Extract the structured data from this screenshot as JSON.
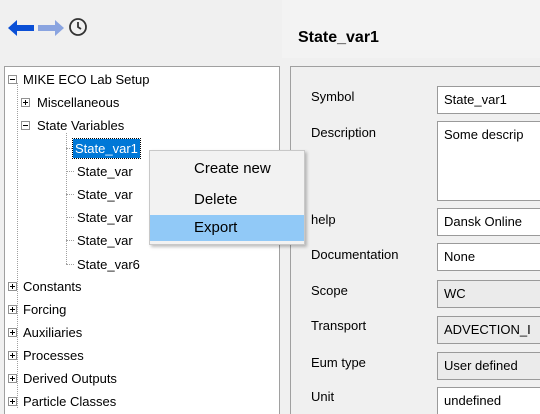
{
  "header": {
    "title": "State_var1"
  },
  "nav": {
    "back_icon": "arrow-left-icon",
    "forward_icon": "arrow-right-icon",
    "history_icon": "clock-icon",
    "accent": "#0a4fd6",
    "disabled": "#8aa4e0"
  },
  "tree": {
    "root": "MIKE ECO Lab Setup",
    "miscellaneous": "Miscellaneous",
    "state_variables": "State Variables",
    "state_vars": [
      "State_var1",
      "State_var",
      "State_var",
      "State_var",
      "State_var",
      "State_var6"
    ],
    "constants": "Constants",
    "forcing": "Forcing",
    "auxiliaries": "Auxiliaries",
    "processes": "Processes",
    "derived_outputs": "Derived Outputs",
    "particle_classes": "Particle Classes"
  },
  "props": {
    "symbol_label": "Symbol",
    "symbol_value": "State_var1",
    "description_label": "Description",
    "description_value": "Some descrip",
    "online_help_label": "help",
    "online_help_value": "Dansk Online",
    "documentation_label": "Documentation",
    "documentation_value": "None",
    "scope_label": "Scope",
    "scope_value": "WC",
    "transport_label": "Transport",
    "transport_value": "ADVECTION_I",
    "eum_type_label": "Eum type",
    "eum_type_value": "User defined",
    "unit_label": "Unit",
    "unit_value": "undefined"
  },
  "context_menu": {
    "create_new": "Create new",
    "delete": "Delete",
    "export": "Export"
  }
}
